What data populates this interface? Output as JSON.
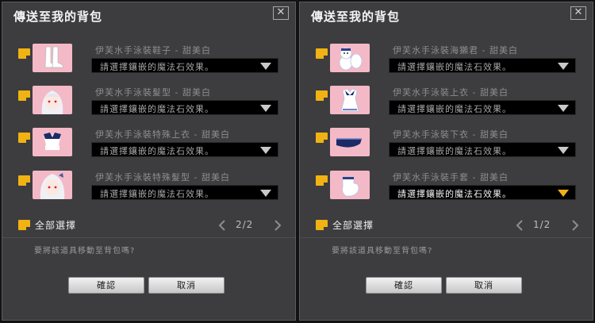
{
  "dialogs": [
    {
      "title": "傳送至我的背包",
      "close_glyph": "✕",
      "items": [
        {
          "name": "伊芙水手泳裝鞋子 - 甜美白",
          "gem_select": "請選擇鑲嵌的魔法石效果。",
          "icon": "boots-icon",
          "active": false
        },
        {
          "name": "伊芙水手泳裝髮型 - 甜美白",
          "gem_select": "請選擇鑲嵌的魔法石效果。",
          "icon": "hairstyle-icon",
          "active": false
        },
        {
          "name": "伊芙水手泳裝特殊上衣 - 甜美白",
          "gem_select": "請選擇鑲嵌的魔法石效果。",
          "icon": "special-top-icon",
          "active": false
        },
        {
          "name": "伊芙水手泳裝特殊髮型 - 甜美白",
          "gem_select": "請選擇鑲嵌的魔法石效果。",
          "icon": "special-hairstyle-icon",
          "active": false
        }
      ],
      "select_all": "全部選擇",
      "pager": "2/2",
      "question": "要將該道具移動至背包嗎?",
      "ok": "確認",
      "cancel": "取消"
    },
    {
      "title": "傳送至我的背包",
      "close_glyph": "✕",
      "items": [
        {
          "name": "伊芙水手泳裝海獺君 - 甜美白",
          "gem_select": "請選擇鑲嵌的魔法石效果。",
          "icon": "sea-otter-icon",
          "active": false
        },
        {
          "name": "伊芙水手泳裝上衣 - 甜美白",
          "gem_select": "請選擇鑲嵌的魔法石效果。",
          "icon": "top-icon",
          "active": false
        },
        {
          "name": "伊芙水手泳裝下衣 - 甜美白",
          "gem_select": "請選擇鑲嵌的魔法石效果。",
          "icon": "bottom-icon",
          "active": false
        },
        {
          "name": "伊芙水手泳裝手套 - 甜美白",
          "gem_select": "請選擇鑲嵌的魔法石效果。",
          "icon": "gloves-icon",
          "active": true
        }
      ],
      "select_all": "全部選擇",
      "pager": "1/2",
      "question": "要將該道具移動至背包嗎?",
      "ok": "確認",
      "cancel": "取消"
    }
  ],
  "colors": {
    "panel_bg": "#3d3d3f",
    "checkbox": "#f1b313",
    "thumb_bg": "#f4b9c7",
    "active_arrow": "#f0b01b"
  }
}
